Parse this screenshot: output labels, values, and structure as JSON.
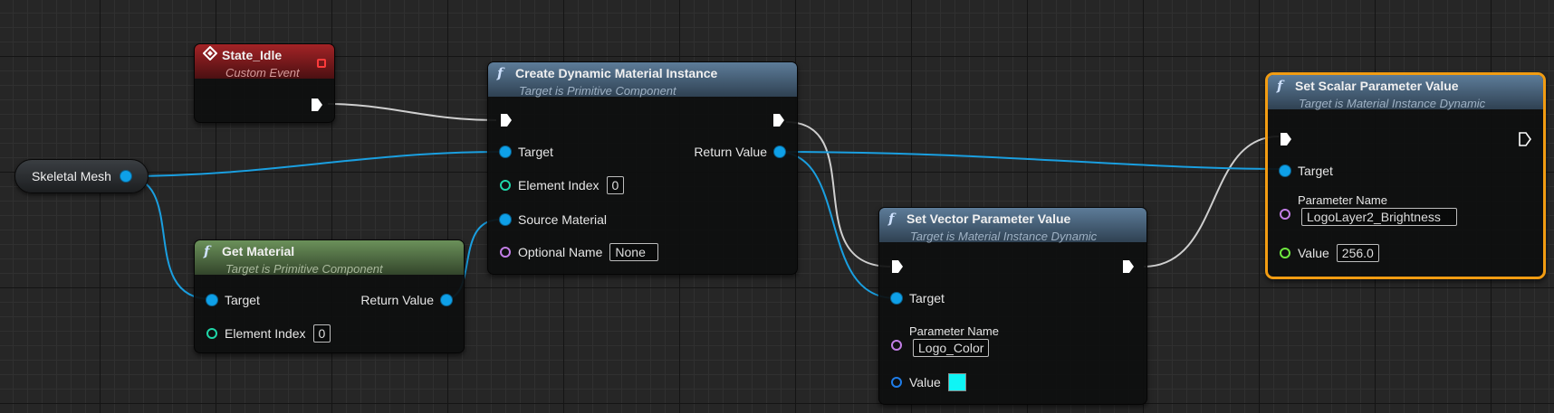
{
  "canvas": {
    "background": "#262626"
  },
  "wire_colors": {
    "exec": "#cfcfcf",
    "object": "#1a9fe0"
  },
  "nodes": {
    "state_idle": {
      "title": "State_Idle",
      "subtitle": "Custom Event",
      "icon": "event-diamond-icon"
    },
    "skeletal_mesh": {
      "label": "Skeletal Mesh"
    },
    "get_material": {
      "title": "Get Material",
      "subtitle": "Target is Primitive Component",
      "icon": "function-icon",
      "inputs": {
        "target": "Target",
        "element_index": "Element Index",
        "element_index_value": "0"
      },
      "outputs": {
        "return_value": "Return Value"
      }
    },
    "create_dmi": {
      "title": "Create Dynamic Material Instance",
      "subtitle": "Target is Primitive Component",
      "icon": "function-icon",
      "inputs": {
        "target": "Target",
        "element_index": "Element Index",
        "element_index_value": "0",
        "source_material": "Source Material",
        "optional_name": "Optional Name",
        "optional_name_value": "None"
      },
      "outputs": {
        "return_value": "Return Value"
      }
    },
    "set_vector": {
      "title": "Set Vector Parameter Value",
      "subtitle": "Target is Material Instance Dynamic",
      "icon": "function-icon",
      "inputs": {
        "target": "Target",
        "parameter_name": "Parameter Name",
        "parameter_name_value": "Logo_Color",
        "value": "Value",
        "value_color": "#0ff5f5"
      }
    },
    "set_scalar": {
      "title": "Set Scalar Parameter Value",
      "subtitle": "Target is Material Instance Dynamic",
      "icon": "function-icon",
      "selected": true,
      "inputs": {
        "target": "Target",
        "parameter_name": "Parameter Name",
        "parameter_name_value": "LogoLayer2_Brightness",
        "value": "Value",
        "value_value": "256.0"
      }
    }
  }
}
